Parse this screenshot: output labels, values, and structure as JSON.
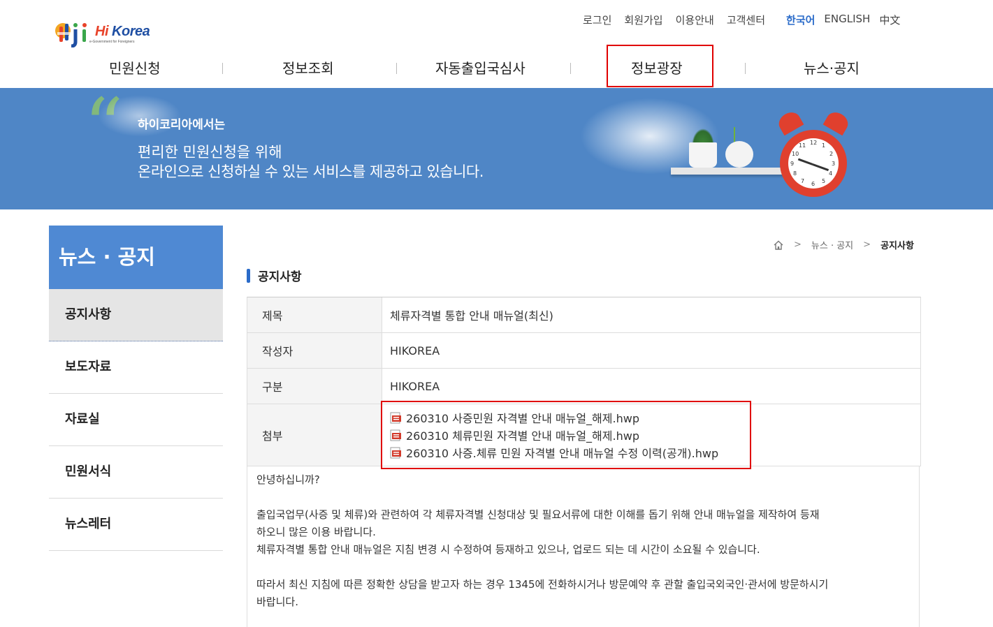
{
  "header": {
    "logo": {
      "brand_hi": "Hi",
      "brand_rest": " Korea",
      "tagline": "e-Government for Foreigners"
    },
    "util_links": [
      "로그인",
      "회원가입",
      "이용안내",
      "고객센터"
    ],
    "languages": [
      {
        "label": "한국어",
        "active": true
      },
      {
        "label": "ENGLISH",
        "active": false
      },
      {
        "label": "中文",
        "active": false
      }
    ],
    "gnb": [
      "민원신청",
      "정보조회",
      "자동출입국심사",
      "정보광장",
      "뉴스·공지"
    ]
  },
  "banner": {
    "line1": "하이코리아에서는",
    "line2": "편리한 민원신청을 위해",
    "line3": "온라인으로 신청하실 수 있는 서비스를 제공하고 있습니다.",
    "clock_numbers": [
      "12",
      "1",
      "2",
      "3",
      "4",
      "5",
      "6",
      "7",
      "8",
      "9",
      "10",
      "11"
    ]
  },
  "sidebar": {
    "title": "뉴스 · 공지",
    "items": [
      {
        "label": "공지사항",
        "active": true
      },
      {
        "label": "보도자료",
        "active": false
      },
      {
        "label": "자료실",
        "active": false
      },
      {
        "label": "민원서식",
        "active": false
      },
      {
        "label": "뉴스레터",
        "active": false
      }
    ]
  },
  "breadcrumb": {
    "level1": "뉴스 · 공지",
    "current": "공지사항"
  },
  "page_title": "공지사항",
  "board": {
    "title_label": "제목",
    "title_value": "체류자격별 통합 안내 매뉴얼(최신)",
    "author_label": "작성자",
    "author_value": "HIKOREA",
    "category_label": "구분",
    "category_value": "HIKOREA",
    "attach_label": "첨부",
    "attachments": [
      "260310 사증민원 자격별 안내 매뉴얼_해제.hwp",
      "260310 체류민원 자격별 안내 매뉴얼_해제.hwp",
      "260310 사증.체류 민원 자격별 안내 매뉴얼 수정 이력(공개).hwp"
    ]
  },
  "body": {
    "greeting": "안녕하십니까?",
    "para1_line1": "출입국업무(사증 및 체류)와 관련하여 각 체류자격별 신청대상 및 필요서류에 대한 이해를 돕기 위해 안내 매뉴얼을 제작하여 등재",
    "para1_line2": "하오니 많은 이용 바랍니다.",
    "para2": "체류자격별 통합 안내 매뉴얼은 지침 변경 시 수정하여 등재하고 있으나, 업로드 되는 데 시간이 소요될 수 있습니다.",
    "para3_line1": "따라서 최신 지침에 따른 정확한 상담을 받고자 하는 경우 1345에 전화하시거나 방문예약 후 관할 출입국외국인·관서에 방문하시기",
    "para3_line2": "바랍니다."
  },
  "colors": {
    "accent": "#2a6bc9",
    "banner_bg": "#4f86c6",
    "sidebar_head": "#4f89d3",
    "highlight_box": "#e00000"
  },
  "icons": [
    "home-icon",
    "chevron-right-icon",
    "hwp-file-icon"
  ]
}
